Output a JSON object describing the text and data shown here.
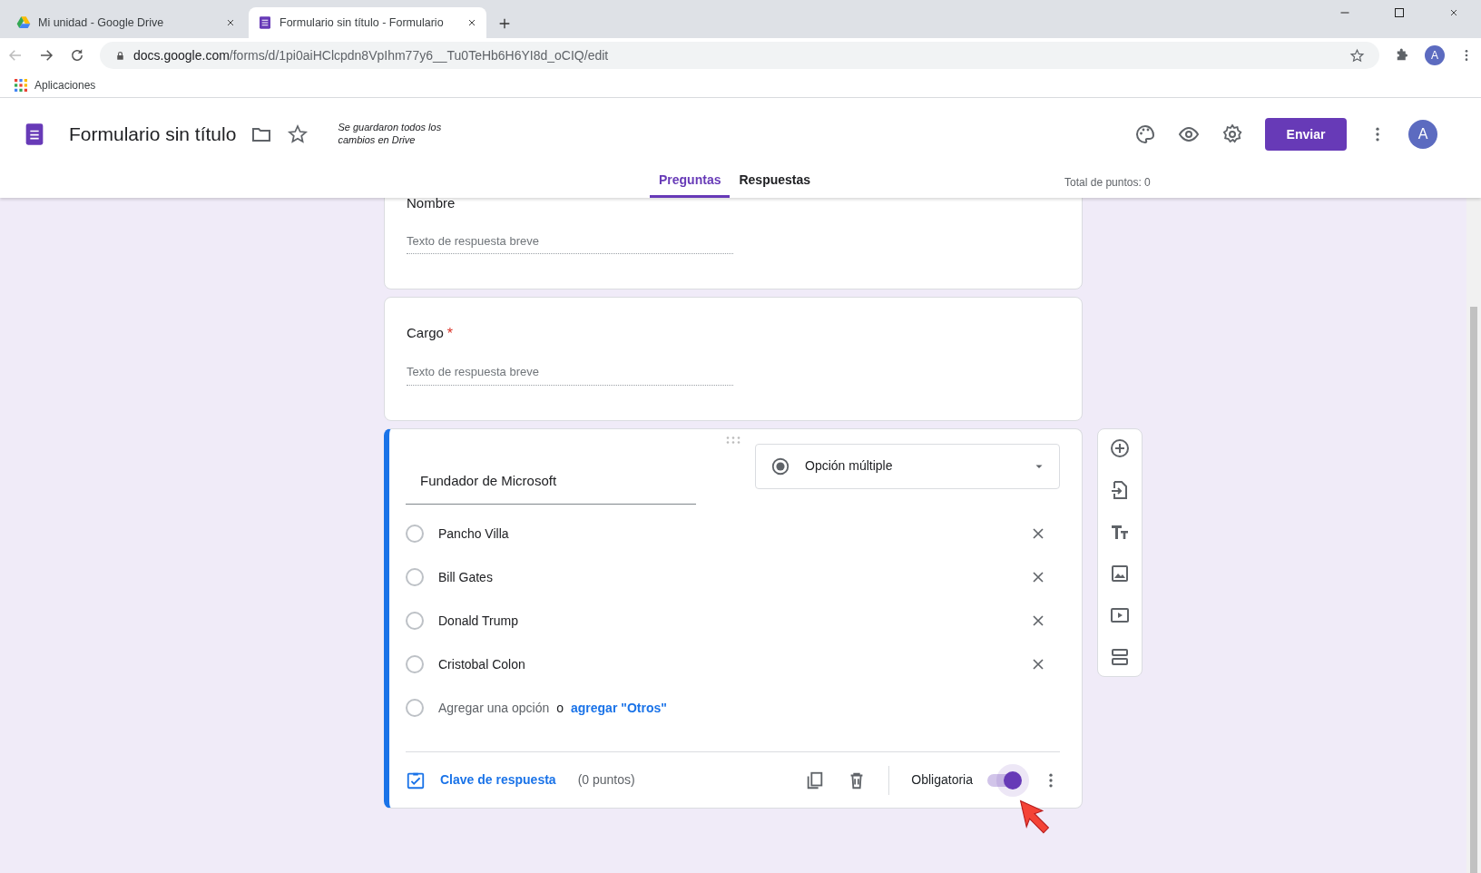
{
  "browser": {
    "tabs": [
      {
        "title": "Mi unidad - Google Drive",
        "kind": "drive",
        "selected": false
      },
      {
        "title": "Formulario sin título - Formulario",
        "kind": "forms",
        "selected": true
      }
    ],
    "url_domain": "docs.google.com",
    "url_path": "/forms/d/1pi0aiHClcpdn8VpIhm77y6__Tu0TeHb6H6YI8d_oCIQ/edit",
    "bookmark": "Aplicaciones",
    "profile_initial": "A"
  },
  "form_header": {
    "title": "Formulario sin título",
    "save_status": "Se guardaron todos los cambios en Drive",
    "send_button": "Enviar",
    "avatar_initial": "A",
    "tabs": [
      {
        "label": "Preguntas",
        "selected": true
      },
      {
        "label": "Respuestas",
        "selected": false
      }
    ],
    "total_points": "Total de puntos: 0"
  },
  "questions": [
    {
      "kind": "short",
      "title": "Nombre",
      "placeholder": "Texto de respuesta breve",
      "selected": false
    },
    {
      "kind": "short",
      "title": "Cargo",
      "required_mark": "*",
      "placeholder": "Texto de respuesta breve",
      "selected": false
    },
    {
      "kind": "choice",
      "title": "Fundador de Microsoft",
      "selected": true,
      "type_label": "Opción múltiple",
      "options": [
        "Pancho Villa",
        "Bill Gates",
        "Donald Trump",
        "Cristobal Colon"
      ],
      "add_option": "Agregar una opción",
      "add_or": "o",
      "add_other": "agregar \"Otros\"",
      "answer_key": "Clave de respuesta",
      "points": "(0 puntos)",
      "required_label": "Obligatoria",
      "required": true
    }
  ]
}
